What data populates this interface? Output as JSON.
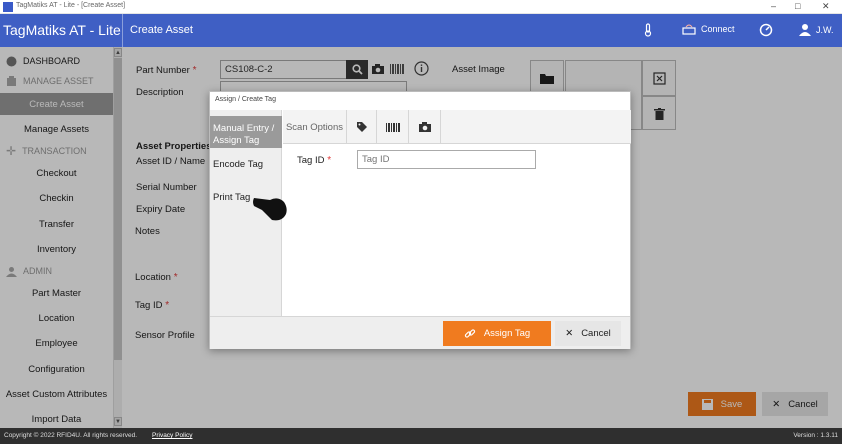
{
  "window": {
    "title": "TagMatiks AT - Lite - [Create Asset]",
    "minimize": "–",
    "maximize": "□",
    "close": "✕"
  },
  "header": {
    "brand": "TagMatiks AT - Lite",
    "page_title": "Create Asset",
    "connect_label": "Connect",
    "user_label": "J.W."
  },
  "sidebar": {
    "dashboard": "DASHBOARD",
    "manage_asset": "MANAGE ASSET",
    "create_asset": "Create Asset",
    "manage_assets": "Manage Assets",
    "transaction": "TRANSACTION",
    "checkout": "Checkout",
    "checkin": "Checkin",
    "transfer": "Transfer",
    "inventory": "Inventory",
    "admin": "ADMIN",
    "part_master": "Part Master",
    "location": "Location",
    "employee": "Employee",
    "configuration": "Configuration",
    "asset_custom_attributes": "Asset Custom Attributes",
    "import_data": "Import Data"
  },
  "form": {
    "part_number_label": "Part Number",
    "part_number_value": "CS108-C-2",
    "required_mark": "*",
    "asset_image_label": "Asset Image",
    "description_label": "Description",
    "asset_properties_label": "Asset Properties",
    "asset_id_label": "Asset ID / Name",
    "serial_number_label": "Serial Number",
    "expiry_date_label": "Expiry Date",
    "notes_label": "Notes",
    "location_label": "Location",
    "tag_id_label": "Tag ID",
    "sensor_profile_label": "Sensor Profile",
    "save_label": "Save",
    "cancel_label": "Cancel"
  },
  "modal": {
    "title": "Assign / Create Tag",
    "left_tabs": {
      "manual": "Manual Entry / Assign Tag",
      "encode": "Encode Tag",
      "print": "Print Tag"
    },
    "scan_options": "Scan Options",
    "tag_id_label": "Tag ID",
    "tag_id_placeholder": "Tag ID",
    "assign_label": "Assign Tag",
    "cancel_label": "Cancel"
  },
  "footer": {
    "copyright": "Copyright © 2022 RFID4U. All rights reserved.",
    "privacy": "Privacy Policy",
    "version": "Version : 1.3.11"
  },
  "colors": {
    "header_blue": "#3f5fc4",
    "accent_orange": "#f07b1f",
    "active_gray": "#9a9a9a"
  }
}
